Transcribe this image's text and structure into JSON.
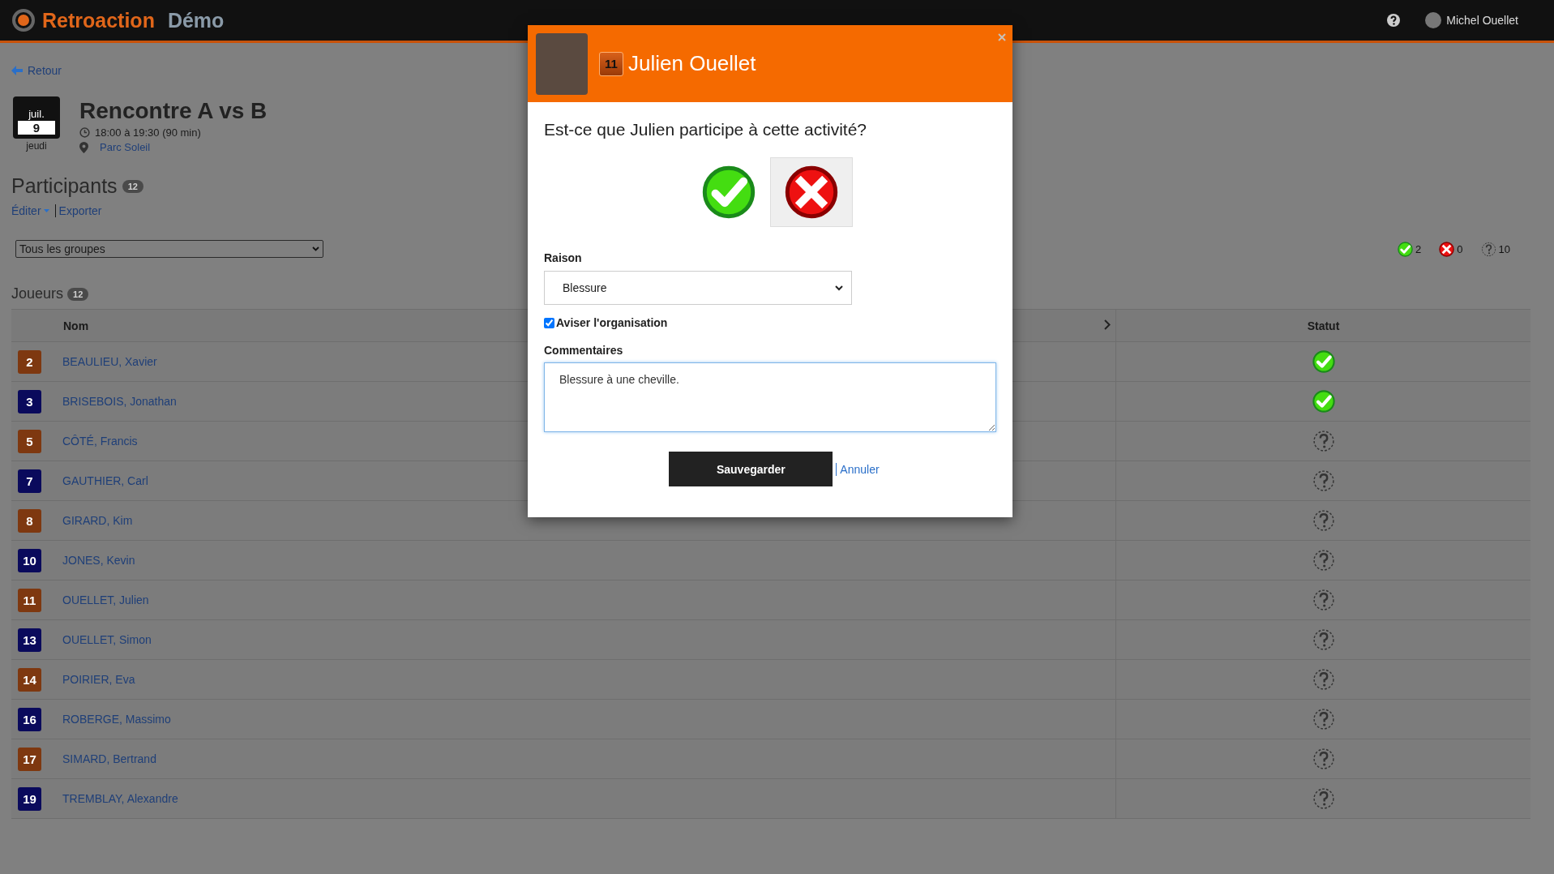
{
  "header": {
    "logo": "Retroaction",
    "edition": "Démo",
    "user_name": "Michel Ouellet"
  },
  "back_link": "Retour",
  "event": {
    "month": "juil.",
    "day": "9",
    "weekday": "jeudi",
    "title": "Rencontre A vs B",
    "time": "18:00 à 19:30 (90 min)",
    "location": "Parc Soleil"
  },
  "participants": {
    "title": "Participants",
    "count": "12",
    "actions": [
      {
        "label": "Éditer",
        "kind": "dropdown"
      },
      {
        "label": "Exporter",
        "kind": "link"
      }
    ],
    "group_filter": "Tous les groupes",
    "summary": [
      {
        "kind": "present",
        "count": "2"
      },
      {
        "kind": "absent",
        "count": "0"
      },
      {
        "kind": "unknown",
        "count": "10"
      }
    ]
  },
  "players": {
    "title": "Joueurs",
    "count": "12",
    "columns": [
      "Nom",
      "Statut"
    ],
    "rows": [
      {
        "number": "2",
        "name": "BEAULIEU, Xavier",
        "color": "#7e3810",
        "kind": "present"
      },
      {
        "number": "3",
        "name": "BRISEBOIS, Jonathan",
        "color": "#0a0a5c",
        "kind": "present"
      },
      {
        "number": "5",
        "name": "CÔTÉ, Francis",
        "color": "#7e3810",
        "kind": "unknown"
      },
      {
        "number": "7",
        "name": "GAUTHIER, Carl",
        "color": "#0a0a5c",
        "kind": "unknown"
      },
      {
        "number": "8",
        "name": "GIRARD, Kim",
        "color": "#7e3810",
        "kind": "unknown"
      },
      {
        "number": "10",
        "name": "JONES, Kevin",
        "color": "#0a0a5c",
        "kind": "unknown"
      },
      {
        "number": "11",
        "name": "OUELLET, Julien",
        "color": "#7e3810",
        "kind": "unknown"
      },
      {
        "number": "13",
        "name": "OUELLET, Simon",
        "color": "#0a0a5c",
        "kind": "unknown"
      },
      {
        "number": "14",
        "name": "POIRIER, Eva",
        "color": "#7e3810",
        "kind": "unknown"
      },
      {
        "number": "16",
        "name": "ROBERGE, Massimo",
        "color": "#0a0a5c",
        "kind": "unknown"
      },
      {
        "number": "17",
        "name": "SIMARD, Bertrand",
        "color": "#7e3810",
        "kind": "unknown"
      },
      {
        "number": "19",
        "name": "TREMBLAY, Alexandre",
        "color": "#0a0a5c",
        "kind": "unknown"
      }
    ]
  },
  "dialog": {
    "number": "11",
    "player_name": "Julien Ouellet",
    "question": "Est-ce que Julien participe à cette activité?",
    "choices": [
      {
        "kind": "present",
        "selected": false
      },
      {
        "kind": "absent",
        "selected": true
      }
    ],
    "reason_label": "Raison",
    "reason": "Blessure",
    "notify": {
      "label": "Aviser l'organisation",
      "checked": true
    },
    "comments_label": "Commentaires",
    "comments": "Blessure à une cheville.",
    "save": "Sauvegarder",
    "cancel": "Annuler"
  }
}
